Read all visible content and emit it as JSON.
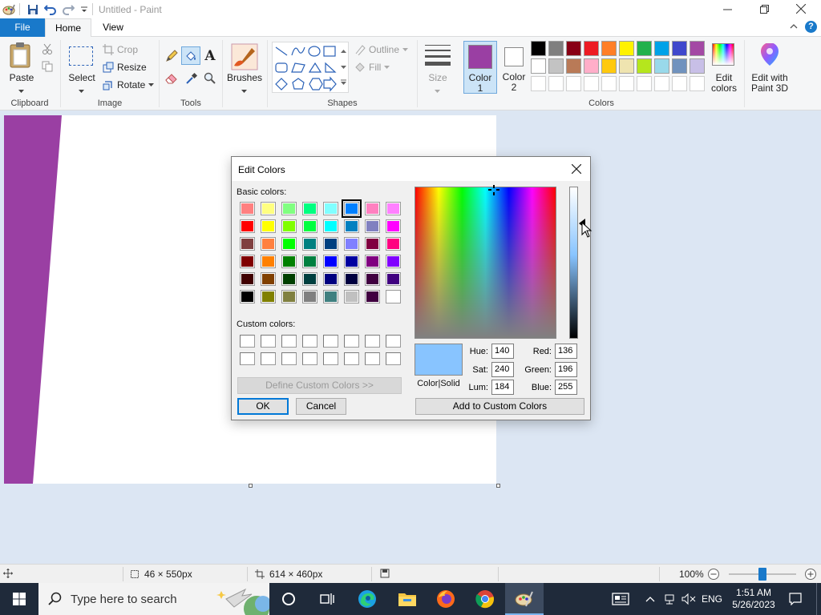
{
  "window": {
    "title": "Untitled - Paint",
    "minimize_icon": "minimize-icon",
    "maximize_icon": "restore-icon",
    "close_icon": "close-icon"
  },
  "ribbon_tabs": [
    "File",
    "Home",
    "View"
  ],
  "ribbon": {
    "clipboard": {
      "paste_label": "Paste",
      "group_label": "Clipboard"
    },
    "image": {
      "select_label": "Select",
      "crop_label": "Crop",
      "resize_label": "Resize",
      "rotate_label": "Rotate",
      "group_label": "Image"
    },
    "tools": {
      "group_label": "Tools"
    },
    "brushes": {
      "label": "Brushes"
    },
    "shapes": {
      "outline_label": "Outline",
      "fill_label": "Fill",
      "group_label": "Shapes"
    },
    "size": {
      "label": "Size"
    },
    "color1": {
      "label_line1": "Color",
      "label_line2": "1",
      "color": "#9a3fa3"
    },
    "color2": {
      "label_line1": "Color",
      "label_line2": "2",
      "color": "#ffffff"
    },
    "edit_colors": {
      "label_line1": "Edit",
      "label_line2": "colors"
    },
    "edit_3d": {
      "label_line1": "Edit with",
      "label_line2": "Paint 3D"
    },
    "colors_group_label": "Colors",
    "palette_row1": [
      "#000000",
      "#7f7f7f",
      "#880015",
      "#ed1c24",
      "#ff7f27",
      "#fff200",
      "#22b14c",
      "#00a2e8",
      "#3f48cc",
      "#a349a4"
    ],
    "palette_row2": [
      "#ffffff",
      "#c3c3c3",
      "#b97a57",
      "#ffaec9",
      "#ffc90e",
      "#efe4b0",
      "#b5e61d",
      "#99d9ea",
      "#7092be",
      "#c8bfe7"
    ]
  },
  "canvas": {
    "stripe_color": "#9a3fa3"
  },
  "dialog": {
    "title": "Edit Colors",
    "basic_colors_label": "Basic colors:",
    "custom_colors_label": "Custom colors:",
    "define_custom_label": "Define Custom Colors >>",
    "ok_label": "OK",
    "cancel_label": "Cancel",
    "add_custom_label": "Add to Custom Colors",
    "color_solid_label": "Color|Solid",
    "preview_color": "#88c4ff",
    "selected_basic_index": 5,
    "basic_colors": [
      "#ff8080",
      "#ffff80",
      "#80ff80",
      "#00ff80",
      "#80ffff",
      "#0080ff",
      "#ff80c0",
      "#ff80ff",
      "#ff0000",
      "#ffff00",
      "#80ff00",
      "#00ff40",
      "#00ffff",
      "#0080c0",
      "#8080c0",
      "#ff00ff",
      "#804040",
      "#ff8040",
      "#00ff00",
      "#008080",
      "#004080",
      "#8080ff",
      "#800040",
      "#ff0080",
      "#800000",
      "#ff8000",
      "#008000",
      "#008040",
      "#0000ff",
      "#0000a0",
      "#800080",
      "#8000ff",
      "#400000",
      "#804000",
      "#004000",
      "#004040",
      "#000080",
      "#000040",
      "#400040",
      "#400080",
      "#000000",
      "#808000",
      "#808040",
      "#808080",
      "#408080",
      "#c0c0c0",
      "#400040",
      "#ffffff"
    ],
    "fields": {
      "hue_label": "Hue:",
      "hue": "140",
      "sat_label": "Sat:",
      "sat": "240",
      "lum_label": "Lum:",
      "lum": "184",
      "red_label": "Red:",
      "red": "136",
      "green_label": "Green:",
      "green": "196",
      "blue_label": "Blue:",
      "blue": "255"
    }
  },
  "statusbar": {
    "selection_size": "46 × 550px",
    "canvas_size": "614 × 460px",
    "zoom": "100%",
    "zoom_level_fraction": 0.5
  },
  "taskbar": {
    "search_placeholder": "Type here to search",
    "language": "ENG",
    "time": "1:51 AM",
    "date": "5/26/2023"
  }
}
